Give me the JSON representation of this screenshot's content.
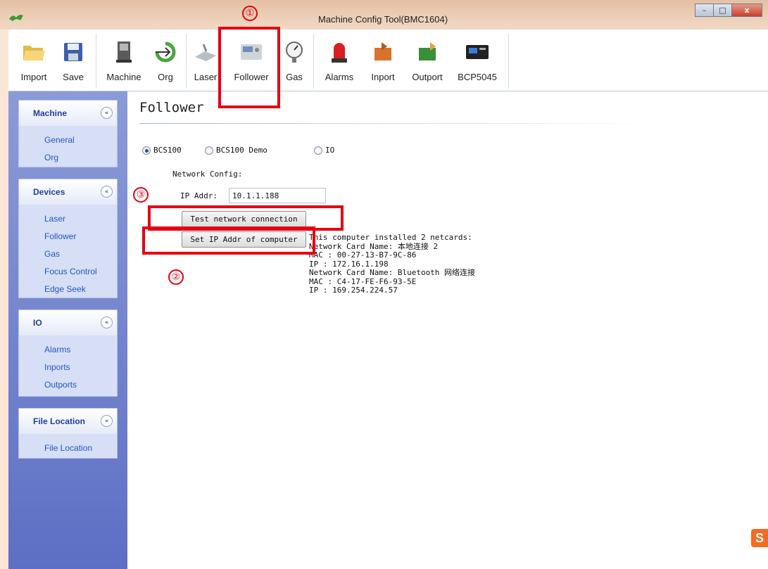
{
  "window": {
    "title": "Machine Config Tool(BMC1604)",
    "minimize_label": "–",
    "maximize_label": "□",
    "close_label": "x"
  },
  "toolbar": {
    "items": [
      {
        "label": "Import",
        "icon": "folder-open-icon"
      },
      {
        "label": "Save",
        "icon": "floppy-disk-icon"
      },
      {
        "label": "Machine",
        "icon": "machine-icon"
      },
      {
        "label": "Org",
        "icon": "origin-arrow-icon"
      },
      {
        "label": "Laser",
        "icon": "laser-icon"
      },
      {
        "label": "Follower",
        "icon": "follower-device-icon"
      },
      {
        "label": "Gas",
        "icon": "pressure-gauge-icon"
      },
      {
        "label": "Alarms",
        "icon": "alarm-light-icon"
      },
      {
        "label": "Inport",
        "icon": "inport-icon"
      },
      {
        "label": "Outport",
        "icon": "outport-icon"
      },
      {
        "label": "BCP5045",
        "icon": "controller-panel-icon"
      }
    ]
  },
  "sidebar": {
    "groups": [
      {
        "title": "Machine",
        "items": [
          "General",
          "Org"
        ]
      },
      {
        "title": "Devices",
        "items": [
          "Laser",
          "Follower",
          "Gas",
          "Focus Control",
          "Edge Seek"
        ]
      },
      {
        "title": "IO",
        "items": [
          "Alarms",
          "Inports",
          "Outports"
        ]
      },
      {
        "title": "File Location",
        "items": [
          "File Location"
        ]
      }
    ],
    "collapse_glyph": "«"
  },
  "main": {
    "title": "Follower",
    "radio_options": [
      {
        "label": "BCS100",
        "checked": true
      },
      {
        "label": "BCS100 Demo",
        "checked": false
      },
      {
        "label": "IO",
        "checked": false
      }
    ],
    "network_config_label": "Network Config:",
    "ip_label": "IP Addr:",
    "ip_value": "10.1.1.188",
    "test_button": "Test network connection",
    "set_ip_button": "Set IP Addr of computer",
    "netinfo": [
      "This computer installed 2 netcards:",
      "Network Card Name: 本地连接 2",
      "MAC : 00-27-13-B7-9C-86",
      "IP : 172.16.1.198",
      "Network Card Name: Bluetooth 网络连接",
      "MAC : C4-17-FE-F6-93-5E",
      "IP : 169.254.224.57"
    ]
  },
  "annotations": {
    "num1": "①",
    "num2": "②",
    "num3": "③",
    "color": "#e60012"
  },
  "watermark": {
    "glyph": "S"
  }
}
